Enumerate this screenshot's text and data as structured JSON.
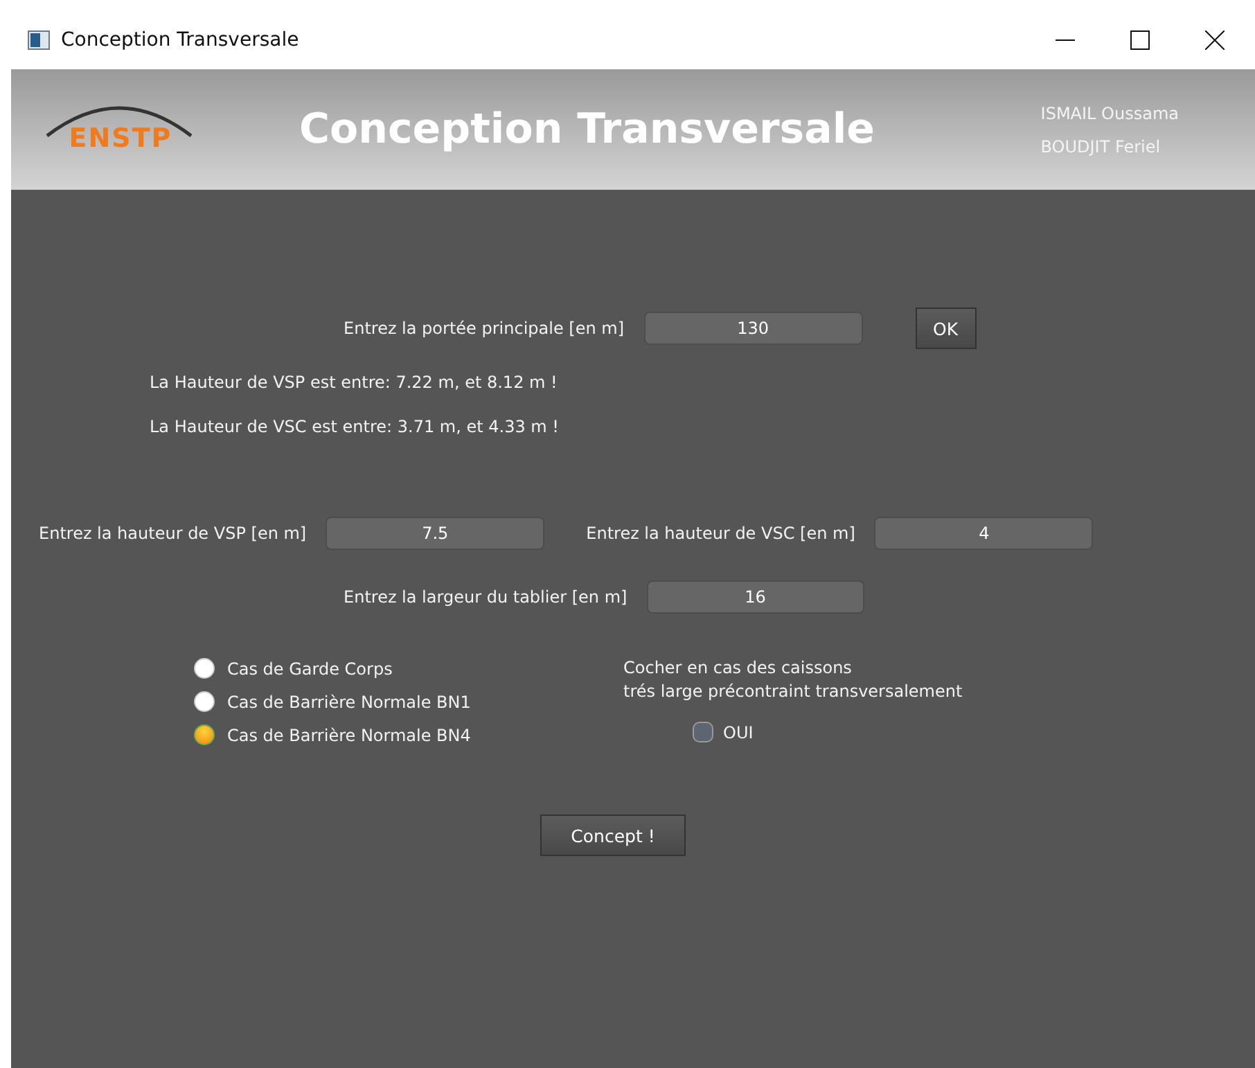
{
  "window": {
    "title": "Conception Transversale"
  },
  "header": {
    "logo_text": "ENSTP",
    "title": "Conception Transversale",
    "authors": [
      "ISMAIL Oussama",
      "BOUDJIT Feriel"
    ]
  },
  "span": {
    "label": "Entrez la portée principale [en m]",
    "value": "130",
    "button": "OK"
  },
  "results": [
    "La Hauteur de VSP est entre: 7.22 m, et 8.12 m !",
    "La Hauteur de VSC est entre: 3.71 m, et 4.33 m !"
  ],
  "heights": [
    {
      "label": "Entrez la hauteur de VSP [en m]",
      "value": "7.5"
    },
    {
      "label": "Entrez la hauteur de VSC [en m]",
      "value": "4"
    }
  ],
  "width": {
    "label": "Entrez la largeur du tablier [en m]",
    "value": "16"
  },
  "barriers": [
    {
      "label": "Cas de Garde Corps",
      "selected": false
    },
    {
      "label": "Cas de Barrière Normale BN1",
      "selected": false
    },
    {
      "label": "Cas de Barrière Normale BN4",
      "selected": true
    }
  ],
  "caissons": {
    "note": [
      "Cocher en cas des caissons",
      "trés large précontraint transversalement"
    ],
    "checkbox": {
      "label": "OUI",
      "checked": false
    }
  },
  "submit": "Concept !"
}
